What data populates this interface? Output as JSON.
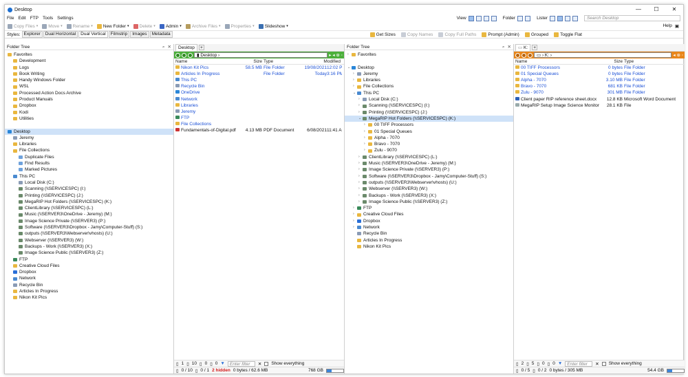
{
  "window": {
    "title": "Desktop",
    "controls": [
      "—",
      "☐",
      "✕"
    ]
  },
  "menu": [
    "File",
    "Edit",
    "FTP",
    "Tools",
    "Settings"
  ],
  "menu_right": {
    "view": "View",
    "folder": "Folder",
    "lister": "Lister",
    "search_placeholder": "Search Desktop"
  },
  "toolbar": [
    {
      "label": "Copy Files",
      "enabled": false,
      "color": "#9aa7b8"
    },
    {
      "label": "Move",
      "enabled": false,
      "color": "#9aa7b8"
    },
    {
      "label": "Rename",
      "enabled": false,
      "color": "#9aa7b8"
    },
    {
      "label": "New Folder",
      "enabled": true,
      "color": "#e9b73f"
    },
    {
      "label": "Delete",
      "enabled": false,
      "color": "#d66"
    },
    {
      "label": "Admin",
      "enabled": true,
      "color": "#3a66c4"
    },
    {
      "label": "Archive Files",
      "enabled": false,
      "color": "#b59c5e"
    },
    {
      "label": "Properties",
      "enabled": false,
      "color": "#9aa7b8"
    },
    {
      "label": "Slideshow",
      "enabled": true,
      "color": "#3a6fb0"
    }
  ],
  "help": "Help",
  "styles": {
    "label": "Styles:",
    "items": [
      "Explorer",
      "Dual Horizontal",
      "Dual Vertical",
      "Filmstrip",
      "Images",
      "Metadata"
    ],
    "active": "Dual Vertical"
  },
  "styles_right": [
    {
      "label": "Get Sizes",
      "enabled": true
    },
    {
      "label": "Copy Names",
      "enabled": false
    },
    {
      "label": "Copy Full Paths",
      "enabled": false
    },
    {
      "label": "Prompt (Admin)",
      "enabled": true
    },
    {
      "label": "Grouped",
      "enabled": true
    },
    {
      "label": "Toggle Flat",
      "enabled": true
    }
  ],
  "left_tree": {
    "title": "Folder Tree",
    "items": [
      {
        "d": 0,
        "t": "Favorites",
        "c": "#e9b73f"
      },
      {
        "d": 1,
        "t": "Development",
        "c": "#e9b73f"
      },
      {
        "d": 1,
        "t": "Logs",
        "c": "#e9b73f"
      },
      {
        "d": 1,
        "t": "Book Writing",
        "c": "#e9b73f"
      },
      {
        "d": 1,
        "t": "Handy Windows Folder",
        "c": "#e9b73f"
      },
      {
        "d": 1,
        "t": "WSL",
        "c": "#e9b73f"
      },
      {
        "d": 1,
        "t": "Processed Action Docs Archive",
        "c": "#e9b73f"
      },
      {
        "d": 1,
        "t": "Product Manuals",
        "c": "#e9b73f"
      },
      {
        "d": 1,
        "t": "Dropbox",
        "c": "#e9b73f"
      },
      {
        "d": 1,
        "t": "Kodi",
        "c": "#e9b73f"
      },
      {
        "d": 1,
        "t": "Utilities",
        "c": "#e9b73f"
      },
      {
        "d": 0,
        "t": "",
        "c": ""
      },
      {
        "d": 0,
        "t": "Desktop",
        "c": "#2a86d8",
        "sel": true
      },
      {
        "d": 1,
        "t": "Jeremy",
        "c": "#8a9bb5"
      },
      {
        "d": 1,
        "t": "Libraries",
        "c": "#e9b73f"
      },
      {
        "d": 1,
        "t": "File Collections",
        "c": "#e9b73f"
      },
      {
        "d": 2,
        "t": "Duplicate Files",
        "c": "#6fa2dc"
      },
      {
        "d": 2,
        "t": "Find Results",
        "c": "#6fa2dc"
      },
      {
        "d": 2,
        "t": "Marked Pictures",
        "c": "#6fa2dc"
      },
      {
        "d": 1,
        "t": "This PC",
        "c": "#4a8ad0"
      },
      {
        "d": 2,
        "t": "Local Disk (C:)",
        "c": "#8a9bb5"
      },
      {
        "d": 2,
        "t": "Scanning (\\\\SERVICESPC) (I:)",
        "c": "#6b8a6b"
      },
      {
        "d": 2,
        "t": "Printing (\\\\SERVICESPC) (J:)",
        "c": "#6b8a6b"
      },
      {
        "d": 2,
        "t": "MegaRIP Hot Folders (\\\\SERVICESPC) (K:)",
        "c": "#6b8a6b"
      },
      {
        "d": 2,
        "t": "ClientLibrary (\\\\SERVICESPC) (L:)",
        "c": "#6b8a6b"
      },
      {
        "d": 2,
        "t": "Music (\\\\SERVER3\\OneDrive - Jeremy) (M:)",
        "c": "#6b8a6b"
      },
      {
        "d": 2,
        "t": "Image Science Private (\\\\SERVER3) (P:)",
        "c": "#6b8a6b"
      },
      {
        "d": 2,
        "t": "Software (\\\\SERVER3\\Dropbox - Jamy\\Computer-Stuff) (S:)",
        "c": "#6b8a6b"
      },
      {
        "d": 2,
        "t": "outputs (\\\\SERVER3\\Webserver\\vhosts) (U:)",
        "c": "#6b8a6b"
      },
      {
        "d": 2,
        "t": "Webserver (\\\\SERVER3) (W:)",
        "c": "#6b8a6b"
      },
      {
        "d": 2,
        "t": "Backups - Work (\\\\SERVER3) (X:)",
        "c": "#6b8a6b"
      },
      {
        "d": 2,
        "t": "Image Science Public (\\\\SERVER3) (Z:)",
        "c": "#6b8a6b"
      },
      {
        "d": 1,
        "t": "FTP",
        "c": "#3a8a5a"
      },
      {
        "d": 1,
        "t": "Creative Cloud Files",
        "c": "#e9b73f"
      },
      {
        "d": 1,
        "t": "Dropbox",
        "c": "#2a6fd8"
      },
      {
        "d": 1,
        "t": "Network",
        "c": "#4a8ad0"
      },
      {
        "d": 1,
        "t": "Recycle Bin",
        "c": "#8a9bb5"
      },
      {
        "d": 1,
        "t": "Articles In Progress",
        "c": "#e9b73f"
      },
      {
        "d": 1,
        "t": "Nikon Kit Pics",
        "c": "#e9b73f"
      }
    ]
  },
  "pane1": {
    "tab": "Desktop",
    "path": "Desktop",
    "color": "#4caf3b",
    "cols": {
      "name": "Name",
      "size": "Size",
      "type": "Type",
      "modified": "Modified"
    },
    "rows": [
      {
        "n": "Nikon Kit Pics",
        "s": "58.5 MB",
        "t": "File Folder",
        "d": "19/08/2021",
        "tm": "12:02 PM",
        "blue": true,
        "c": "#e9b73f"
      },
      {
        "n": "Articles In Progress",
        "s": "",
        "t": "File Folder",
        "d": "Today",
        "tm": "3:16 PM",
        "blue": true,
        "c": "#e9b73f"
      },
      {
        "n": "This PC",
        "s": "",
        "t": "",
        "d": "",
        "tm": "",
        "blue": true,
        "c": "#4a8ad0"
      },
      {
        "n": "Recycle Bin",
        "s": "",
        "t": "",
        "d": "",
        "tm": "",
        "blue": true,
        "c": "#8a9bb5"
      },
      {
        "n": "OneDrive",
        "s": "",
        "t": "",
        "d": "",
        "tm": "",
        "blue": true,
        "c": "#2a86d8"
      },
      {
        "n": "Network",
        "s": "",
        "t": "",
        "d": "",
        "tm": "",
        "blue": true,
        "c": "#4a8ad0"
      },
      {
        "n": "Libraries",
        "s": "",
        "t": "",
        "d": "",
        "tm": "",
        "blue": true,
        "c": "#e9b73f"
      },
      {
        "n": "Jeremy",
        "s": "",
        "t": "",
        "d": "",
        "tm": "",
        "blue": true,
        "c": "#8a9bb5"
      },
      {
        "n": "FTP",
        "s": "",
        "t": "",
        "d": "",
        "tm": "",
        "blue": true,
        "c": "#3a8a5a"
      },
      {
        "n": "File Collections",
        "s": "",
        "t": "",
        "d": "",
        "tm": "",
        "blue": true,
        "c": "#e9b73f"
      },
      {
        "n": "Fundamentals-of-Digital.pdf",
        "s": "4.13 MB",
        "t": "PDF Document",
        "d": "6/08/2021",
        "tm": "11:41 AM",
        "blue": false,
        "c": "#c33"
      }
    ],
    "status1": [
      "1",
      "10",
      "0",
      "0"
    ],
    "filter": "Enter filter",
    "show_all": "Show everything",
    "status2": {
      "sel": "0 / 10",
      "sel2": "0 / 1",
      "hidden": "2 hidden",
      "bytes": "0 bytes / 62.6 MB",
      "free": "768 GB"
    }
  },
  "middle_tree": {
    "title": "Folder Tree",
    "items": [
      {
        "d": 0,
        "t": "Favorites",
        "c": "#e9b73f",
        "ex": "›"
      },
      {
        "d": 0,
        "t": "",
        "c": ""
      },
      {
        "d": 0,
        "t": "Desktop",
        "c": "#2a86d8",
        "ex": "⌄"
      },
      {
        "d": 1,
        "t": "Jeremy",
        "c": "#8a9bb5",
        "ex": "›"
      },
      {
        "d": 1,
        "t": "Libraries",
        "c": "#e9b73f",
        "ex": "›"
      },
      {
        "d": 1,
        "t": "File Collections",
        "c": "#e9b73f",
        "ex": "›"
      },
      {
        "d": 1,
        "t": "This PC",
        "c": "#4a8ad0",
        "ex": "⌄"
      },
      {
        "d": 2,
        "t": "Local Disk (C:)",
        "c": "#8a9bb5",
        "ex": "›"
      },
      {
        "d": 2,
        "t": "Scanning (\\\\SERVICESPC) (I:)",
        "c": "#6b8a6b",
        "ex": "›"
      },
      {
        "d": 2,
        "t": "Printing (\\\\SERVICESPC) (J:)",
        "c": "#6b8a6b",
        "ex": "›"
      },
      {
        "d": 2,
        "t": "MegaRIP Hot Folders (\\\\SERVICESPC) (K:)",
        "c": "#6b8a6b",
        "ex": "⌄",
        "sel": true
      },
      {
        "d": 3,
        "t": "00 TIFF Processors",
        "c": "#e9b73f",
        "ex": "›"
      },
      {
        "d": 3,
        "t": "01 Special Queues",
        "c": "#e9b73f",
        "ex": "›"
      },
      {
        "d": 3,
        "t": "Alpha - 7070",
        "c": "#e9b73f",
        "ex": "›"
      },
      {
        "d": 3,
        "t": "Bravo - 7070",
        "c": "#e9b73f",
        "ex": "›"
      },
      {
        "d": 3,
        "t": "Zulu - 9070",
        "c": "#e9b73f",
        "ex": "›"
      },
      {
        "d": 2,
        "t": "ClientLibrary (\\\\SERVICESPC) (L:)",
        "c": "#6b8a6b",
        "ex": "›"
      },
      {
        "d": 2,
        "t": "Music (\\\\SERVER3\\OneDrive - Jeremy) (M:)",
        "c": "#6b8a6b",
        "ex": "›"
      },
      {
        "d": 2,
        "t": "Image Science Private (\\\\SERVER3) (P:)",
        "c": "#6b8a6b",
        "ex": "›"
      },
      {
        "d": 2,
        "t": "Software (\\\\SERVER3\\Dropbox - Jamy\\Computer-Stuff) (S:)",
        "c": "#6b8a6b",
        "ex": "›"
      },
      {
        "d": 2,
        "t": "outputs (\\\\SERVER3\\Webserver\\vhosts) (U:)",
        "c": "#6b8a6b",
        "ex": "›"
      },
      {
        "d": 2,
        "t": "Webserver (\\\\SERVER3) (W:)",
        "c": "#6b8a6b",
        "ex": "›"
      },
      {
        "d": 2,
        "t": "Backups - Work (\\\\SERVER3) (X:)",
        "c": "#6b8a6b",
        "ex": "›"
      },
      {
        "d": 2,
        "t": "Image Science Public (\\\\SERVER3) (Z:)",
        "c": "#6b8a6b",
        "ex": "›"
      },
      {
        "d": 1,
        "t": "FTP",
        "c": "#3a8a5a",
        "ex": "›"
      },
      {
        "d": 1,
        "t": "Creative Cloud Files",
        "c": "#e9b73f",
        "ex": "›"
      },
      {
        "d": 1,
        "t": "Dropbox",
        "c": "#2a6fd8",
        "ex": "›"
      },
      {
        "d": 1,
        "t": "Network",
        "c": "#4a8ad0",
        "ex": "›"
      },
      {
        "d": 1,
        "t": "Recycle Bin",
        "c": "#8a9bb5",
        "ex": ""
      },
      {
        "d": 1,
        "t": "Articles In Progress",
        "c": "#e9b73f",
        "ex": ""
      },
      {
        "d": 1,
        "t": "Nikon Kit Pics",
        "c": "#e9b73f",
        "ex": ""
      }
    ]
  },
  "pane2": {
    "tab": "K:",
    "path": "K:",
    "color": "#e8861a",
    "cols": {
      "name": "Name",
      "size": "Size",
      "type": "Type"
    },
    "rows": [
      {
        "n": "00 TIFF Processors",
        "s": "0 bytes",
        "t": "File Folder",
        "blue": true,
        "c": "#e9b73f"
      },
      {
        "n": "01 Special Queues",
        "s": "0 bytes",
        "t": "File Folder",
        "blue": true,
        "c": "#e9b73f"
      },
      {
        "n": "Alpha - 7070",
        "s": "3.10 MB",
        "t": "File Folder",
        "blue": true,
        "c": "#e9b73f"
      },
      {
        "n": "Bravo - 7070",
        "s": "681 KB",
        "t": "File Folder",
        "blue": true,
        "c": "#e9b73f"
      },
      {
        "n": "Zulu - 9070",
        "s": "301 MB",
        "t": "File Folder",
        "blue": true,
        "c": "#e9b73f"
      },
      {
        "n": "Client paper RIP reference sheet.docx",
        "s": "12.8 KB",
        "t": "Microsoft Word Document",
        "blue": false,
        "c": "#2b5fb8"
      },
      {
        "n": "MegaRIP Setup Image Science Monitor",
        "s": "28.1 KB",
        "t": "File",
        "blue": false,
        "c": "#9aa"
      }
    ],
    "status1": [
      "2",
      "5",
      "0",
      "0"
    ],
    "filter": "Enter filter",
    "show_all": "Show everything",
    "status2": {
      "sel": "0 / 5",
      "sel2": "0 / 2",
      "bytes": "0 bytes / 305 MB",
      "free": "54.4 GB"
    }
  }
}
